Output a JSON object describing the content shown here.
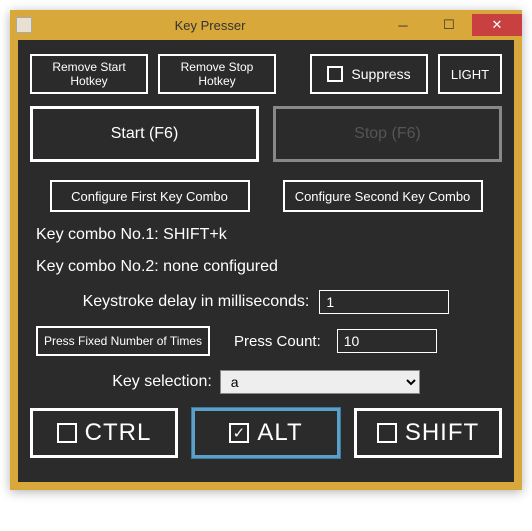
{
  "window": {
    "title": "Key Presser"
  },
  "toolbar": {
    "remove_start": "Remove Start\nHotkey",
    "remove_stop": "Remove Stop\nHotkey",
    "suppress": "Suppress",
    "suppress_checked": false,
    "light": "LIGHT"
  },
  "main": {
    "start_label": "Start (F6)",
    "stop_label": "Stop (F6)"
  },
  "configure": {
    "first": "Configure First Key Combo",
    "second": "Configure Second Key Combo"
  },
  "combos": {
    "line1": "Key combo No.1: SHIFT+k",
    "line2": "Key combo No.2: none configured"
  },
  "delay": {
    "label": "Keystroke delay in milliseconds:",
    "value": "1"
  },
  "fixed": {
    "button": "Press Fixed Number of Times",
    "count_label": "Press Count:",
    "count_value": "10"
  },
  "keysel": {
    "label": "Key selection:",
    "value": "a"
  },
  "mods": {
    "ctrl": "CTRL",
    "ctrl_checked": false,
    "alt": "ALT",
    "alt_checked": true,
    "shift": "SHIFT",
    "shift_checked": false
  }
}
